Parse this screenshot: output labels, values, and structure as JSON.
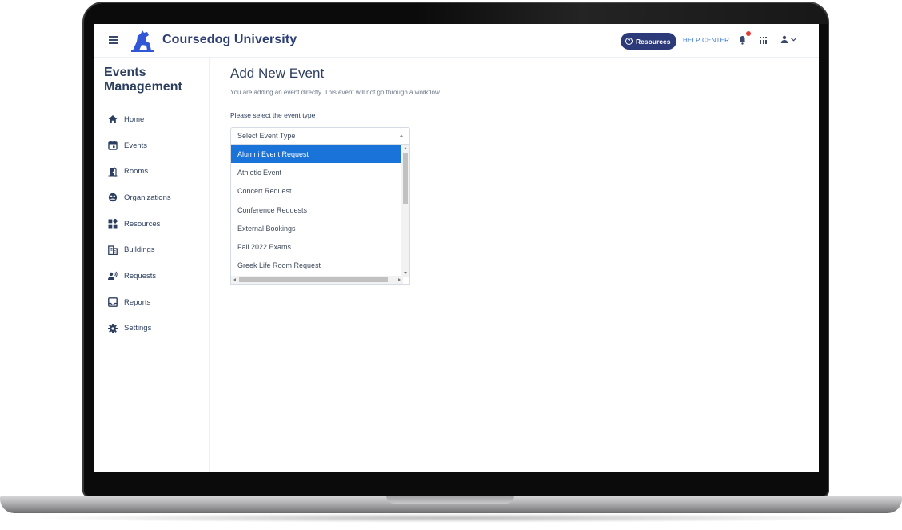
{
  "app": {
    "brand": "Coursedog University",
    "menu_icon": "hamburger-icon",
    "logo_icon": "dog-logo-icon"
  },
  "header": {
    "resources_label": "Resources",
    "help_center_label": "HELP CENTER",
    "notification_icon": "bell-icon",
    "apps_icon": "grid-icon",
    "user_icon": "person-icon"
  },
  "sidebar": {
    "title": "Events Management",
    "items": [
      {
        "label": "Home",
        "icon": "home-icon"
      },
      {
        "label": "Events",
        "icon": "calendar-icon"
      },
      {
        "label": "Rooms",
        "icon": "door-icon"
      },
      {
        "label": "Organizations",
        "icon": "group-icon"
      },
      {
        "label": "Resources",
        "icon": "widgets-icon"
      },
      {
        "label": "Buildings",
        "icon": "building-icon"
      },
      {
        "label": "Requests",
        "icon": "person-voice-icon"
      },
      {
        "label": "Reports",
        "icon": "inbox-icon"
      },
      {
        "label": "Settings",
        "icon": "gear-icon"
      }
    ]
  },
  "main": {
    "title": "Add New Event",
    "subtitle": "You are adding an event directly. This event will not go through a workflow.",
    "field_label": "Please select the event type",
    "select": {
      "placeholder": "Select Event Type",
      "options": [
        "Alumni Event Request",
        "Athletic Event",
        "Concert Request",
        "Conference Requests",
        "External Bookings",
        "Fall 2022 Exams",
        "Greek Life Room Request"
      ],
      "highlighted": "Alumni Event Request"
    }
  },
  "colors": {
    "brand_navy": "#2d3a7a",
    "highlight_blue": "#1a73d9",
    "link_blue": "#3a7bd5",
    "notification_red": "#e53935"
  }
}
